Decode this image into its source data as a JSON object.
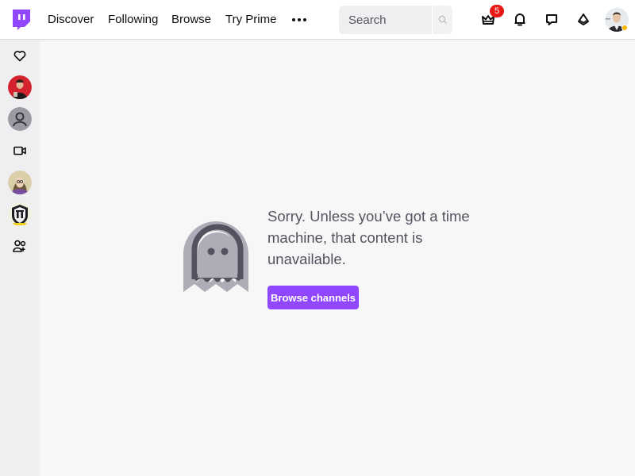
{
  "nav": {
    "links": [
      "Discover",
      "Following",
      "Browse",
      "Try Prime"
    ],
    "search_placeholder": "Search",
    "notification_count": "5"
  },
  "icons": {
    "logo": "twitch-logo",
    "more": "more-dots-icon",
    "search": "search-icon",
    "crown": "crown-icon",
    "bell": "bell-icon",
    "whisper": "message-icon",
    "bits": "bits-icon",
    "sidebar": [
      "heart-icon",
      "channel-avatar",
      "user-icon",
      "video-camera-icon",
      "channel-avatar",
      "channel-avatar",
      "friends-icon"
    ]
  },
  "main": {
    "message": "Sorry. Unless you’ve got a time machine, that content is unavailable.",
    "button_label": "Browse channels"
  },
  "colors": {
    "brand": "#9147ff",
    "badge": "#e91916",
    "text": "#0e0e10",
    "muted": "#53535f",
    "background": "#f7f7f8",
    "sidebar": "#efeff1"
  }
}
